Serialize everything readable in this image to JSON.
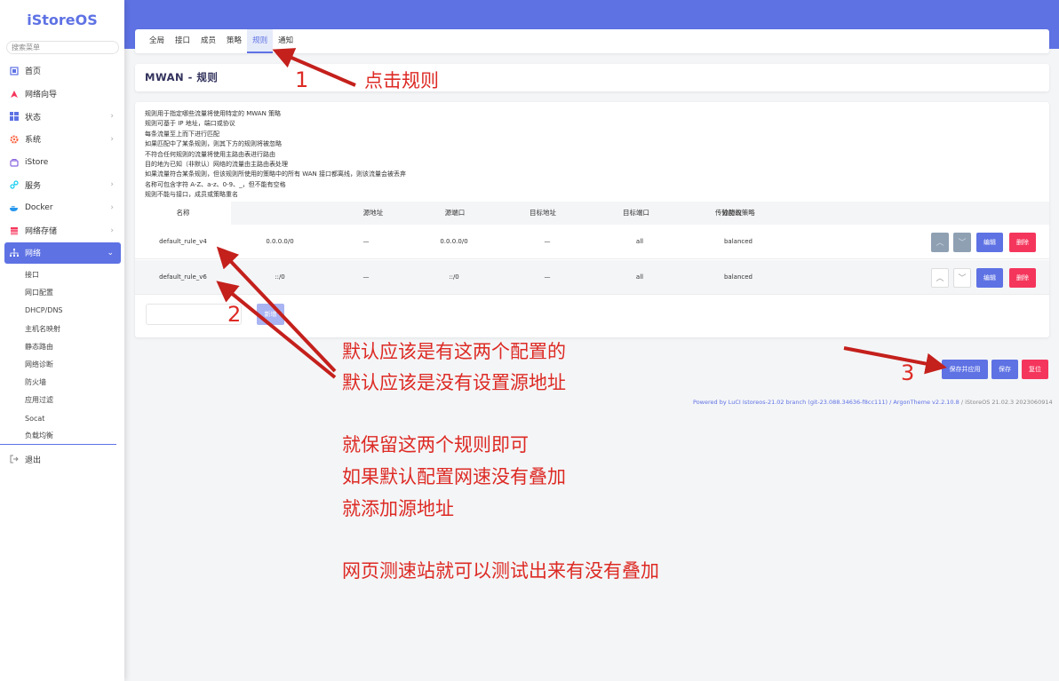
{
  "app": {
    "logo": "iStoreOS",
    "search_placeholder": "搜索菜单"
  },
  "sidebar": {
    "items": [
      {
        "label": "首页",
        "icon": "home-icon",
        "chevron": ""
      },
      {
        "label": "网络向导",
        "icon": "wizard-icon",
        "chevron": ""
      },
      {
        "label": "状态",
        "icon": "dashboard-icon",
        "chevron": "›"
      },
      {
        "label": "系统",
        "icon": "gear-icon",
        "chevron": "›"
      },
      {
        "label": "iStore",
        "icon": "store-icon",
        "chevron": ""
      },
      {
        "label": "服务",
        "icon": "services-icon",
        "chevron": "›"
      },
      {
        "label": "Docker",
        "icon": "docker-icon",
        "chevron": "›"
      },
      {
        "label": "网络存储",
        "icon": "storage-icon",
        "chevron": "›"
      }
    ],
    "active": {
      "label": "网络",
      "icon": "network-icon",
      "chevron": "⌄"
    },
    "sub_items": [
      "接口",
      "网口配置",
      "DHCP/DNS",
      "主机名映射",
      "静态路由",
      "网络诊断",
      "防火墙",
      "应用过滤",
      "Socat",
      "负载均衡"
    ],
    "logout": {
      "label": "退出",
      "icon": "logout-icon"
    }
  },
  "tabs": [
    "全局",
    "接口",
    "成员",
    "策略",
    "规则",
    "通知"
  ],
  "page_title": "MWAN - 规则",
  "description": [
    "规则用于指定哪些流量将使用特定的 MWAN 策略",
    "规则可基于 IP 地址，端口或协议",
    "每条流量至上而下进行匹配",
    "如果匹配中了某条规则，则其下方的规则将被忽略",
    "不符合任何规则的流量将使用主路由表进行路由",
    "目的地为已知（非默认）网络的流量由主路由表处理",
    "如果流量符合某条规则，但该规则所使用的策略中的所有 WAN 接口都离线，则该流量会被丢弃",
    "名称可包含字符 A-Z、a-z、0-9、_，但不能有空格",
    "规则不能与接口，成员或策略重名"
  ],
  "table": {
    "headers": [
      "名称",
      "源地址",
      "源端口",
      "目标地址",
      "目标端口",
      "传输协议",
      "分配的策略"
    ],
    "rows": [
      [
        "default_rule_v4",
        "0.0.0.0/0",
        "—",
        "0.0.0.0/0",
        "—",
        "all",
        "balanced"
      ],
      [
        "default_rule_v6",
        "::/0",
        "—",
        "::/0",
        "—",
        "all",
        "balanced"
      ]
    ],
    "up_arrow": "︿",
    "down_arrow": "﹀",
    "edit_label": "编辑",
    "delete_label": "删除",
    "add_label": "新增"
  },
  "actions": {
    "save_apply": "保存并应用",
    "save": "保存",
    "reset": "复位"
  },
  "footer": {
    "text": "Powered by LuCI Istoreos-21.02 branch (git-23.088.34636-f8cc111) / ArgonTheme v2.2.10.8",
    "version": " / iStoreOS 21.02.3 2023060914"
  },
  "annotations": {
    "n1": "1",
    "n2": "2",
    "n3": "3",
    "click_rules": "点击规则",
    "note_a1": "默认应该是有这两个配置的",
    "note_a2": "默认应该是没有设置源地址",
    "note_b1": "就保留这两个规则即可",
    "note_b2": "如果默认配置网速没有叠加",
    "note_b3": "就添加源地址",
    "note_c1": "网页测速站就可以测试出来有没有叠加"
  },
  "colors": {
    "accent": "#5e72e4",
    "danger": "#f5365c",
    "annotation": "#dd2a24"
  }
}
